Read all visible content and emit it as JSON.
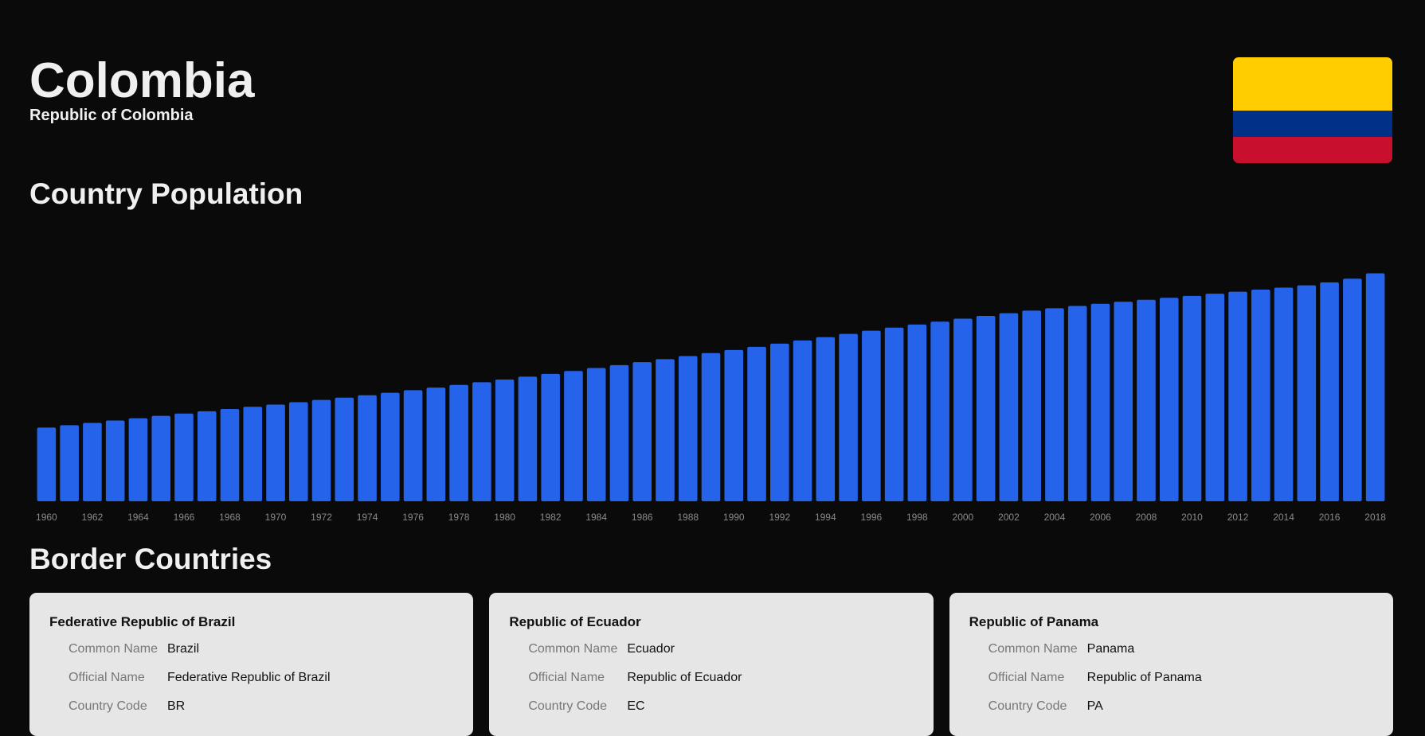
{
  "header": {
    "title": "Colombia",
    "subtitle": "Republic of Colombia"
  },
  "flag": {
    "colors": [
      "#ffcd00",
      "#003087",
      "#c8102e"
    ]
  },
  "population_section": {
    "title": "Country Population"
  },
  "chart_data": {
    "type": "bar",
    "title": "",
    "xlabel": "",
    "ylabel": "",
    "bar_color": "#2563eb",
    "x": [
      1960,
      1961,
      1962,
      1963,
      1964,
      1965,
      1966,
      1967,
      1968,
      1969,
      1970,
      1971,
      1972,
      1973,
      1974,
      1975,
      1976,
      1977,
      1978,
      1979,
      1980,
      1981,
      1982,
      1983,
      1984,
      1985,
      1986,
      1987,
      1988,
      1989,
      1990,
      1991,
      1992,
      1993,
      1994,
      1995,
      1996,
      1997,
      1998,
      1999,
      2000,
      2001,
      2002,
      2003,
      2004,
      2005,
      2006,
      2007,
      2008,
      2009,
      2010,
      2011,
      2012,
      2013,
      2014,
      2015,
      2016,
      2017,
      2018
    ],
    "tick_labels": [
      "1960",
      "1962",
      "1964",
      "1966",
      "1968",
      "1970",
      "1972",
      "1974",
      "1976",
      "1978",
      "1980",
      "1982",
      "1984",
      "1986",
      "1988",
      "1990",
      "1992",
      "1994",
      "1996",
      "1998",
      "2000",
      "2002",
      "2004",
      "2006",
      "2008",
      "2010",
      "2012",
      "2014",
      "2016",
      "2018"
    ],
    "values": [
      16.06,
      16.57,
      17.08,
      17.59,
      18.1,
      18.61,
      19.11,
      19.61,
      20.1,
      20.59,
      21.07,
      21.57,
      22.07,
      22.58,
      23.1,
      23.64,
      24.2,
      24.77,
      25.35,
      25.94,
      26.53,
      27.14,
      27.76,
      28.39,
      29.03,
      29.67,
      30.32,
      30.97,
      31.63,
      32.29,
      32.95,
      33.64,
      34.34,
      35.04,
      35.75,
      36.46,
      37.15,
      37.83,
      38.5,
      39.14,
      39.77,
      40.39,
      40.98,
      41.54,
      42.06,
      42.55,
      43.02,
      43.47,
      43.9,
      44.32,
      44.75,
      45.21,
      45.66,
      46.1,
      46.55,
      47.04,
      47.68,
      48.5,
      49.66
    ],
    "ylim": [
      0,
      52
    ],
    "grid": false
  },
  "borders_section": {
    "title": "Border Countries",
    "labels": {
      "common": "Common Name",
      "official": "Official Name",
      "code": "Country Code"
    },
    "countries": [
      {
        "heading": "Federative Republic of Brazil",
        "common": "Brazil",
        "official": "Federative Republic of Brazil",
        "code": "BR"
      },
      {
        "heading": "Republic of Ecuador",
        "common": "Ecuador",
        "official": "Republic of Ecuador",
        "code": "EC"
      },
      {
        "heading": "Republic of Panama",
        "common": "Panama",
        "official": "Republic of Panama",
        "code": "PA"
      }
    ]
  }
}
